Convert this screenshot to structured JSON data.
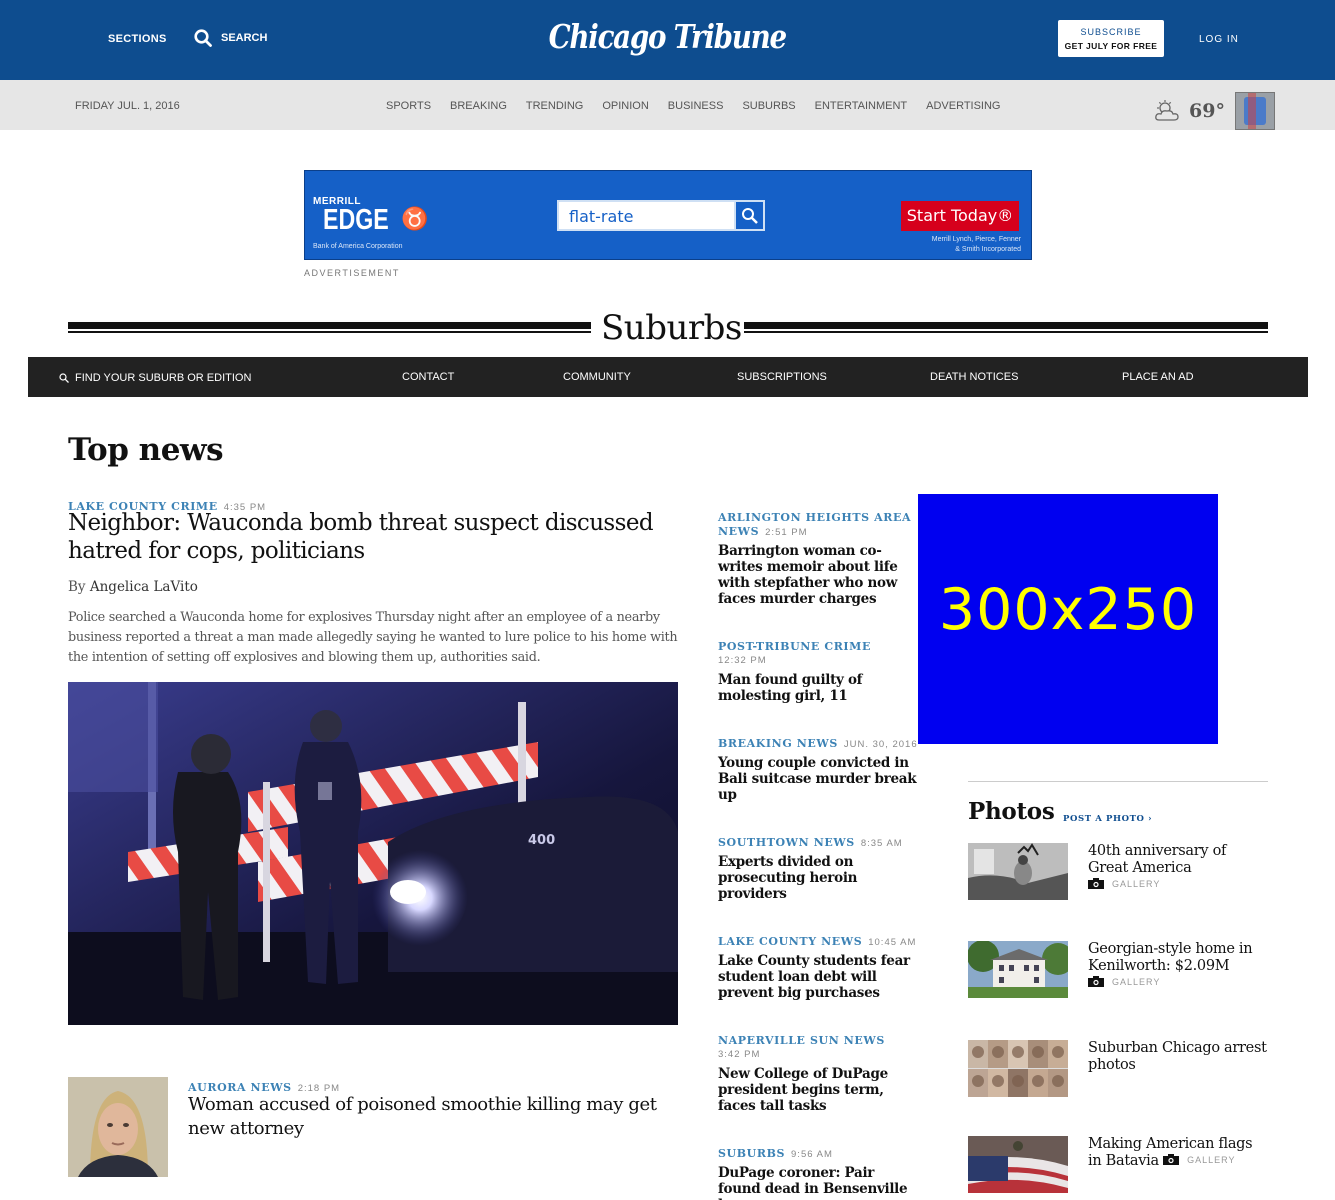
{
  "header": {
    "sections_label": "SECTIONS",
    "search_label": "SEARCH",
    "logo_text": "Chicago Tribune",
    "subscribe_line1": "SUBSCRIBE",
    "subscribe_line2": "GET JULY FOR FREE",
    "login_label": "LOG IN"
  },
  "subnav": {
    "date": "FRIDAY JUL. 1, 2016",
    "links": [
      "SPORTS",
      "BREAKING",
      "TRENDING",
      "OPINION",
      "BUSINESS",
      "SUBURBS",
      "ENTERTAINMENT",
      "ADVERTISING"
    ],
    "weather_temp": "69°",
    "weather_icon": "partly-cloudy-icon"
  },
  "ad_banner": {
    "brand_top": "MERRILL",
    "brand_main": "EDGE",
    "brand_sub": "Bank of America Corporation",
    "search_text": "flat-rate",
    "cta": "Start Today®",
    "fine_print_1": "Merrill Lynch, Pierce, Fenner",
    "fine_print_2": "& Smith Incorporated",
    "label": "ADVERTISEMENT"
  },
  "section": {
    "title": "Suburbs",
    "find_label": "FIND YOUR SUBURB OR EDITION",
    "nav": [
      "CONTACT",
      "COMMUNITY",
      "SUBSCRIPTIONS",
      "DEATH NOTICES",
      "PLACE AN AD"
    ]
  },
  "top_news": {
    "heading": "Top news",
    "lead": {
      "kicker": "LAKE COUNTY CRIME",
      "time": "4:35 PM",
      "headline": "Neighbor: Wauconda bomb threat suspect discussed hatred for cops, politicians",
      "by": "By",
      "author": "Angelica LaVito",
      "summary": "Police searched a Wauconda home for explosives Thursday night after an employee of a nearby business reported a threat a man made allegedly saying he wanted to lure police to his home with the intention of setting off explosives and blowing them up, authorities said."
    },
    "second": {
      "kicker": "AURORA NEWS",
      "time": "2:18 PM",
      "headline": "Woman accused of poisoned smoothie killing may get new attorney"
    }
  },
  "middle": [
    {
      "kicker": "ARLINGTON HEIGHTS AREA NEWS",
      "time": "2:51 PM",
      "headline": "Barrington woman co-writes memoir about life with stepfather who now faces murder charges"
    },
    {
      "kicker": "POST-TRIBUNE CRIME",
      "time": "12:32 PM",
      "headline": "Man found guilty of molesting girl, 11"
    },
    {
      "kicker": "BREAKING NEWS",
      "time": "JUN. 30, 2016",
      "headline": "Young couple convicted in Bali suitcase murder break up"
    },
    {
      "kicker": "SOUTHTOWN NEWS",
      "time": "8:35 AM",
      "headline": "Experts divided on prosecuting heroin providers"
    },
    {
      "kicker": "LAKE COUNTY NEWS",
      "time": "10:45 AM",
      "headline": "Lake County students fear student loan debt will prevent big purchases"
    },
    {
      "kicker": "NAPERVILLE SUN NEWS",
      "time": "3:42 PM",
      "headline": "New College of DuPage president begins term, faces tall tasks"
    },
    {
      "kicker": "SUBURBS",
      "time": "9:56 AM",
      "headline": "DuPage coroner: Pair found dead in Bensenville home"
    }
  ],
  "right": {
    "ad_text": "300x250",
    "photos_title": "Photos",
    "post_photo": "POST A PHOTO ›",
    "gallery_label": "GALLERY",
    "items": [
      {
        "caption": "40th anniversary of Great America",
        "gallery": true
      },
      {
        "caption": "Georgian-style home in Kenilworth: $2.09M",
        "gallery": true
      },
      {
        "caption": "Suburban Chicago arrest photos",
        "gallery": false
      },
      {
        "caption": "Making American flags in Batavia",
        "gallery": true
      }
    ]
  }
}
